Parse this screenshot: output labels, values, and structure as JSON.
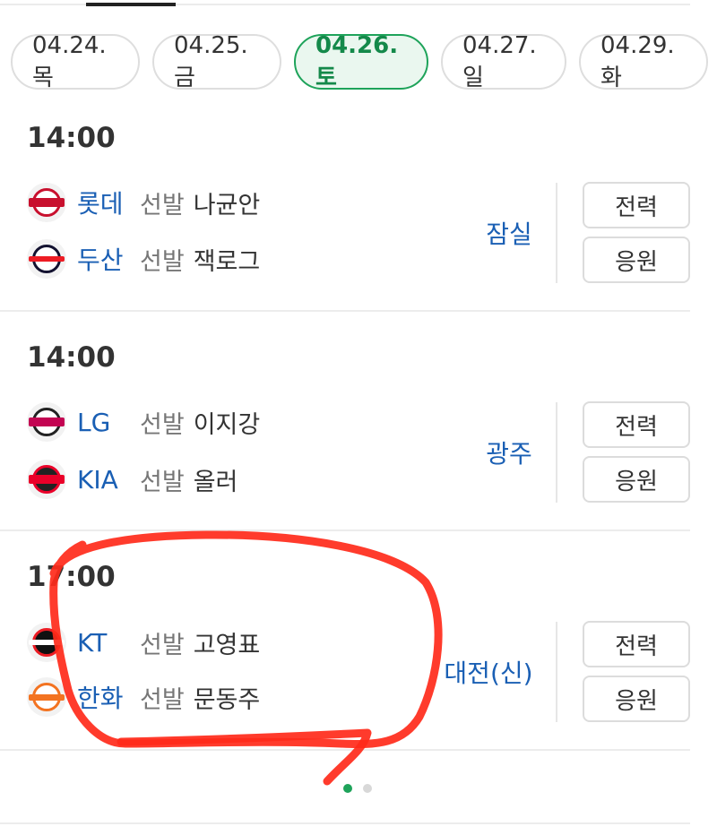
{
  "dates": [
    {
      "label": "04.24.목",
      "active": false
    },
    {
      "label": "04.25.금",
      "active": false
    },
    {
      "label": "04.26.토",
      "active": true
    },
    {
      "label": "04.27.일",
      "active": false
    },
    {
      "label": "04.29.화",
      "active": false
    }
  ],
  "starter_prefix": "선발",
  "buttons": {
    "stats": "전력",
    "cheer": "응원"
  },
  "games": [
    {
      "time": "14:00",
      "venue": "잠실",
      "away": {
        "name": "롯데",
        "starter": "나균안",
        "logo": "giants-logo",
        "color": "#c8102e"
      },
      "home": {
        "name": "두산",
        "starter": "잭로그",
        "logo": "bears-logo",
        "color": "#131230"
      }
    },
    {
      "time": "14:00",
      "venue": "광주",
      "away": {
        "name": "LG",
        "starter": "이지강",
        "logo": "twins-logo",
        "color": "#c30452"
      },
      "home": {
        "name": "KIA",
        "starter": "올러",
        "logo": "tigers-logo",
        "color": "#ea0029"
      }
    },
    {
      "time": "17:00",
      "venue": "대전(신)",
      "away": {
        "name": "KT",
        "starter": "고영표",
        "logo": "ktwiz-logo",
        "color": "#000000"
      },
      "home": {
        "name": "한화",
        "starter": "문동주",
        "logo": "eagles-logo",
        "color": "#f37321"
      }
    }
  ],
  "pagination": {
    "current": 1,
    "total": 2
  },
  "colors": {
    "accent_green": "#1ea35a",
    "team_link_blue": "#1a5fb4",
    "annotation_red": "#ff2a1a"
  }
}
